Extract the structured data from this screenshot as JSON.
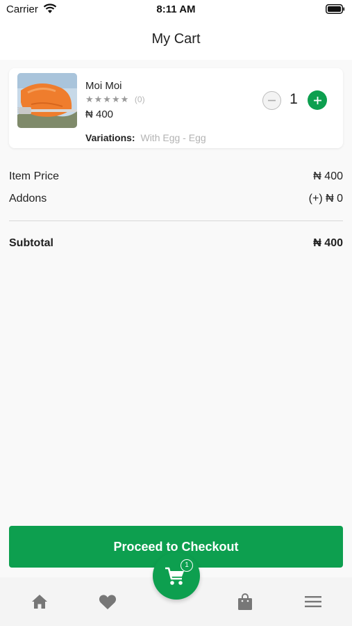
{
  "status_bar": {
    "carrier": "Carrier",
    "time": "8:11 AM"
  },
  "header": {
    "title": "My Cart"
  },
  "cart_items": [
    {
      "name": "Moi Moi",
      "rating_stars": "★★★★★",
      "rating_count": "(0)",
      "price": "₦ 400",
      "variations_label": "Variations:",
      "variations_value": "With Egg - Egg",
      "quantity": "1"
    }
  ],
  "summary": {
    "item_price_label": "Item Price",
    "item_price_value": "₦ 400",
    "addons_label": "Addons",
    "addons_value": "(+) ₦ 0",
    "subtotal_label": "Subtotal",
    "subtotal_value": "₦ 400"
  },
  "checkout": {
    "label": "Proceed to Checkout"
  },
  "bottom_nav": {
    "items": [
      "home-icon",
      "heart-icon",
      "cart-icon",
      "shopping-bag-icon",
      "menu-icon"
    ],
    "cart_badge": "1"
  },
  "colors": {
    "primary": "#0d9f4f",
    "background": "#f9f9f9",
    "muted_text": "#b3b3b3"
  }
}
